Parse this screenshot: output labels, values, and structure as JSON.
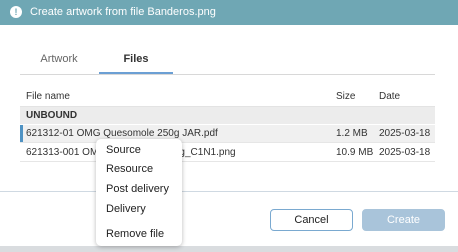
{
  "header": {
    "title": "Create artwork from file Banderos.png",
    "icon": "info-icon"
  },
  "tabs": [
    {
      "label": "Artwork"
    },
    {
      "label": "Files"
    }
  ],
  "table": {
    "columns": {
      "name": "File name",
      "size": "Size",
      "date": "Date"
    },
    "group": "UNBOUND",
    "rows": [
      {
        "name": "621312-01 OMG Quesomole 250g JAR.pdf",
        "size": "1.2 MB",
        "date": "2025-03-18"
      },
      {
        "name": "621313-001 OMG Quesomole 250g_C1N1.png",
        "size": "10.9 MB",
        "date": "2025-03-18"
      }
    ]
  },
  "context_menu": {
    "items": [
      "Source",
      "Resource",
      "Post delivery",
      "Delivery",
      "Remove file"
    ]
  },
  "buttons": {
    "cancel": "Cancel",
    "create": "Create"
  },
  "colors": {
    "header": "#6fa7b4",
    "accent": "#4f93c4",
    "create_disabled": "#a9c4da"
  }
}
